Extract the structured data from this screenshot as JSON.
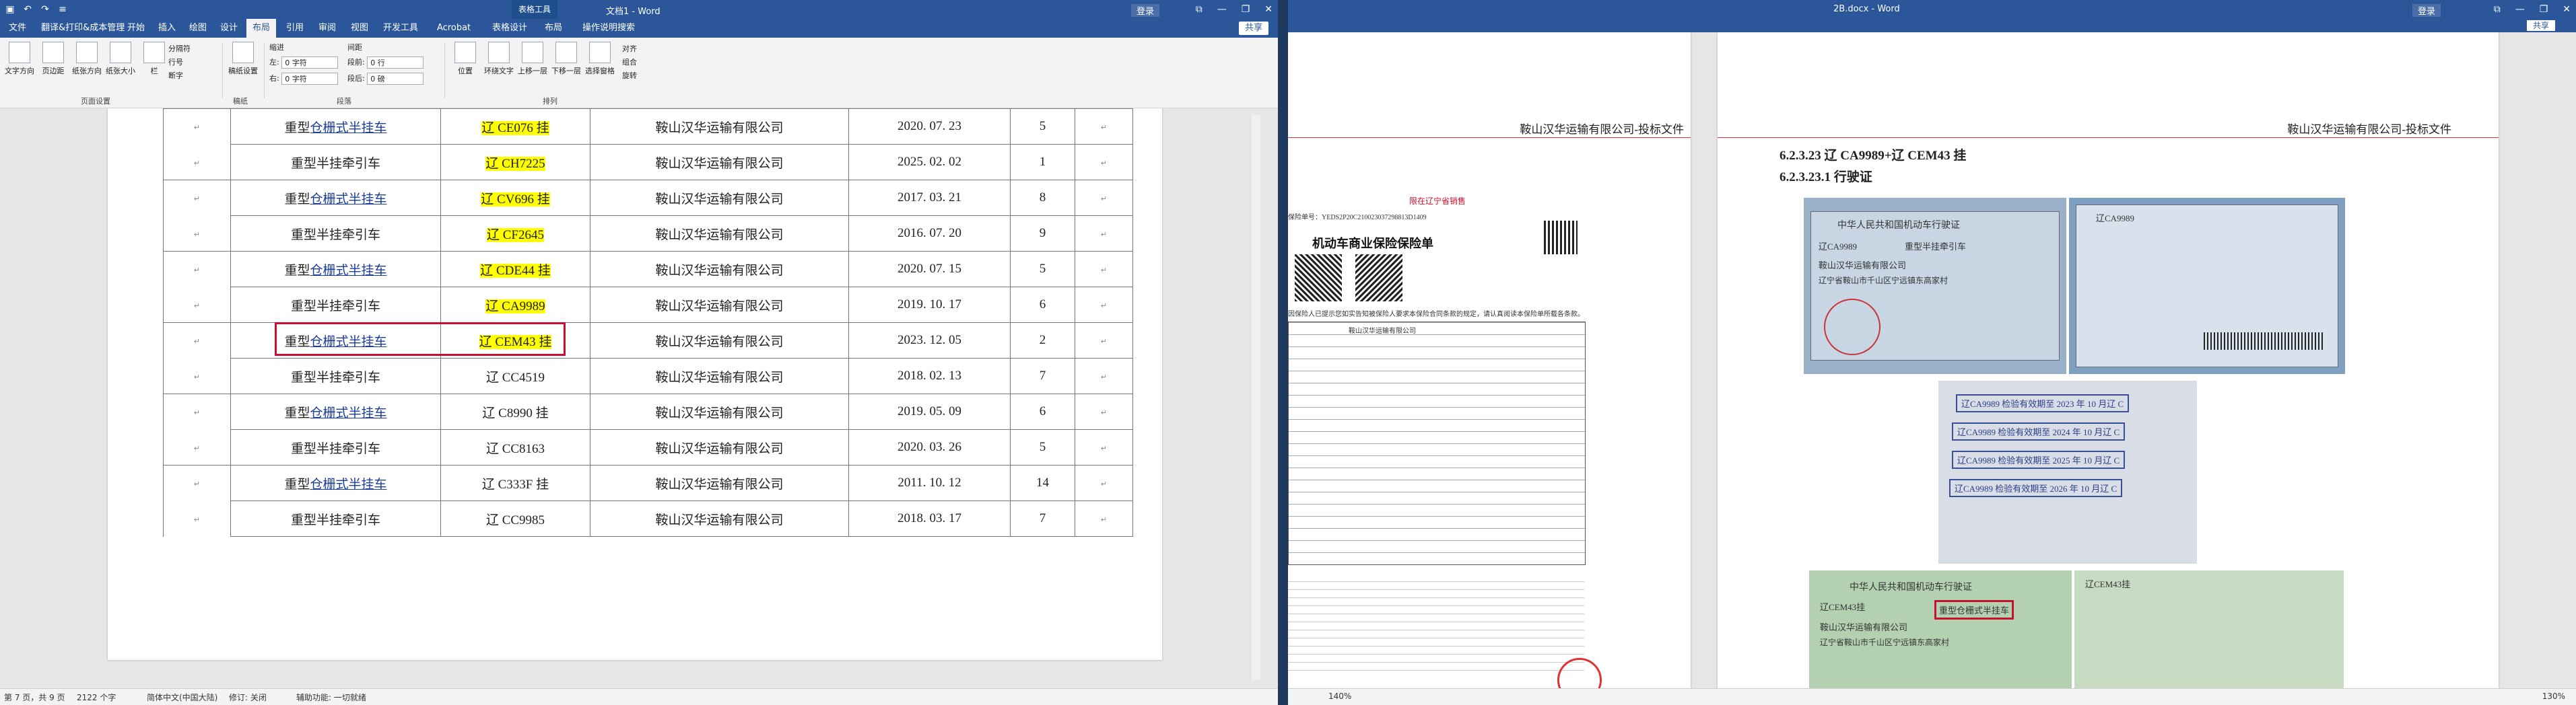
{
  "left": {
    "title": "文档1 - Word",
    "context_tab": "表格工具",
    "account": "登录",
    "share": "共享",
    "tabs": [
      "文件",
      "翻译&打印&成本管理",
      "开始",
      "插入",
      "绘图",
      "设计",
      "布局",
      "引用",
      "审阅",
      "视图",
      "开发工具",
      "Acrobat",
      "表格设计",
      "布局",
      "操作说明搜索"
    ],
    "ribbon": {
      "buttons": [
        "文字方向",
        "页边距",
        "纸张方向",
        "纸张大小",
        "栏"
      ],
      "small": [
        "分隔符",
        "行号",
        "断字"
      ],
      "indent_label": "缩进",
      "spacing_label": "间距",
      "left_label": "左:",
      "right_label": "右:",
      "before_label": "段前:",
      "after_label": "段后:",
      "indent_left": "0 字符",
      "indent_right": "0 字符",
      "space_before": "0 行",
      "space_after": "0 磅",
      "arrange": [
        "位置",
        "环绕文字",
        "上移一层",
        "下移一层",
        "选择窗格"
      ],
      "align": [
        "对齐",
        "组合",
        "旋转"
      ],
      "groups": [
        "页面设置",
        "稿纸",
        "段落",
        "排列"
      ],
      "manuscript": "稿纸设置"
    },
    "table": {
      "rows": [
        {
          "type": "重型",
          "link": "仓栅式半挂车",
          "plate": "辽 CE076 挂",
          "hl": true,
          "company": "鞍山汉华运输有限公司",
          "date": "2020. 07. 23",
          "num": "5"
        },
        {
          "type": "重型半挂牵引车",
          "link": "",
          "plate": "辽 CH7225",
          "hl": true,
          "company": "鞍山汉华运输有限公司",
          "date": "2025. 02. 02",
          "num": "1"
        },
        {
          "type": "重型",
          "link": "仓栅式半挂车",
          "plate": "辽 CV696 挂",
          "hl": true,
          "company": "鞍山汉华运输有限公司",
          "date": "2017. 03. 21",
          "num": "8"
        },
        {
          "type": "重型半挂牵引车",
          "link": "",
          "plate": "辽 CF2645",
          "hl": true,
          "company": "鞍山汉华运输有限公司",
          "date": "2016. 07. 20",
          "num": "9"
        },
        {
          "type": "重型",
          "link": "仓栅式半挂车",
          "plate": "辽 CDE44 挂",
          "hl": true,
          "company": "鞍山汉华运输有限公司",
          "date": "2020. 07. 15",
          "num": "5"
        },
        {
          "type": "重型半挂牵引车",
          "link": "",
          "plate": "辽 CA9989",
          "hl": true,
          "company": "鞍山汉华运输有限公司",
          "date": "2019. 10. 17",
          "num": "6"
        },
        {
          "type": "重型",
          "link": "仓栅式半挂车",
          "plate": "辽 CEM43 挂",
          "hl": true,
          "company": "鞍山汉华运输有限公司",
          "date": "2023. 12. 05",
          "num": "2"
        },
        {
          "type": "重型半挂牵引车",
          "link": "",
          "plate": "辽 CC4519",
          "hl": false,
          "company": "鞍山汉华运输有限公司",
          "date": "2018. 02. 13",
          "num": "7"
        },
        {
          "type": "重型",
          "link": "仓栅式半挂车",
          "plate": "辽 C8990 挂",
          "hl": false,
          "company": "鞍山汉华运输有限公司",
          "date": "2019. 05. 09",
          "num": "6"
        },
        {
          "type": "重型半挂牵引车",
          "link": "",
          "plate": "辽 CC8163",
          "hl": false,
          "company": "鞍山汉华运输有限公司",
          "date": "2020. 03. 26",
          "num": "5"
        },
        {
          "type": "重型",
          "link": "仓栅式半挂车",
          "plate": "辽 C333F 挂",
          "hl": false,
          "company": "鞍山汉华运输有限公司",
          "date": "2011. 10. 12",
          "num": "14"
        },
        {
          "type": "重型半挂牵引车",
          "link": "",
          "plate": "辽 CC9985",
          "hl": false,
          "company": "鞍山汉华运输有限公司",
          "date": "2018. 03. 17",
          "num": "7"
        }
      ]
    },
    "status": {
      "page": "第 7 页，共 9 页",
      "words": "2122 个字",
      "lang": "简体中文(中国大陆)",
      "track": "修订: 关闭",
      "accessibility": "辅助功能: 一切就绪"
    }
  },
  "right": {
    "title": "2B.docx - Word",
    "account": "登录",
    "share": "共享",
    "header": "鞍山汉华运输有限公司-投标文件",
    "heading1": "6.2.3.23    辽 CA9989+辽 CEM43 挂",
    "heading2": "6.2.3.23.1 行驶证",
    "policy": {
      "red_title": "限在辽宁省销售",
      "policy_no": "保险单号：YEDS2P20C210023037298813D1409",
      "title": "机动车商业保险保险单",
      "company_line": "鞍山汉华运输有限公司",
      "notice": "因保险人已提示您如实告知被保险人要求本保险合同条款的规定，请认真阅读本保险单所载各条款。"
    },
    "license": {
      "title": "中华人民共和国机动车行驶证",
      "plate": "辽CA9989",
      "type": "重型半挂牵引车",
      "owner": "鞍山汉华运输有限公司",
      "address": "辽宁省鞍山市千山区宁远镇东高家村",
      "stamp1": "辽CA9989 检验有效期至 2023 年 10 月辽 C",
      "stamp2": "辽CA9989 检验有效期至 2024 年 10 月辽 C",
      "stamp3": "辽CA9989 检验有效期至 2025 年 10 月辽 C",
      "stamp4": "辽CA9989 检验有效期至 2026 年 10 月辽 C",
      "plate2": "辽CEM43挂",
      "type2": "重型仓栅式半挂车"
    },
    "status": {
      "zoom_left": "140%",
      "zoom_right": "130%"
    }
  }
}
